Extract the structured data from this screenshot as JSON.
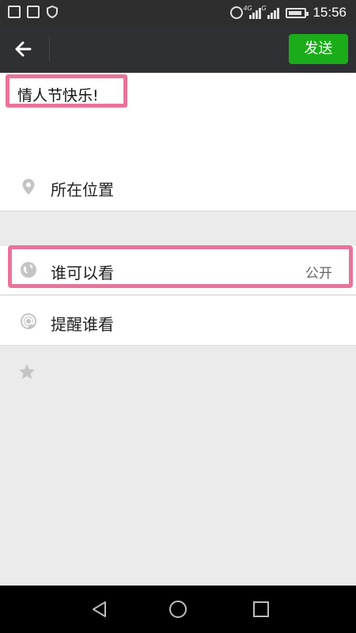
{
  "status_bar": {
    "time": "15:56",
    "network_4g": "4G",
    "network_g": "G",
    "icons": [
      "image-icon",
      "gallery-icon",
      "shield-icon",
      "alarm-icon",
      "signal-icon",
      "battery-icon"
    ]
  },
  "toolbar": {
    "back_icon": "arrow-left-icon",
    "send_label": "发送",
    "send_color": "#1aad19"
  },
  "compose": {
    "message": "情人节快乐!",
    "highlight_color": "#e8749a"
  },
  "options": {
    "location": {
      "label": "所在位置",
      "icon": "location-pin-icon"
    },
    "visibility": {
      "label": "谁可以看",
      "value": "公开",
      "icon": "globe-icon"
    },
    "remind": {
      "label": "提醒谁看",
      "icon": "at-icon"
    },
    "extra_icon": "star-icon"
  },
  "nav": {
    "icons": [
      "back-triangle-icon",
      "home-circle-icon",
      "recent-square-icon"
    ]
  }
}
